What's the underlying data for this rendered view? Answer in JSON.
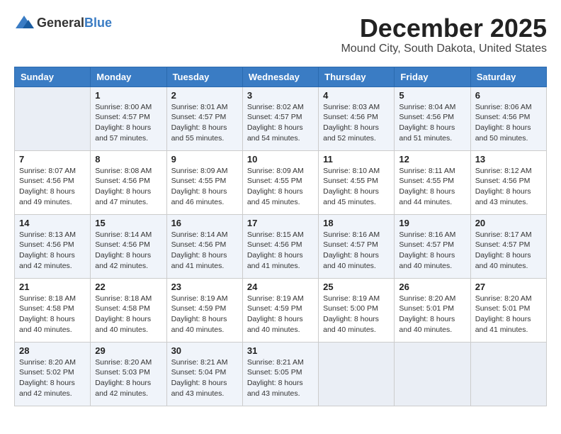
{
  "header": {
    "logo_general": "General",
    "logo_blue": "Blue",
    "month": "December 2025",
    "location": "Mound City, South Dakota, United States"
  },
  "weekdays": [
    "Sunday",
    "Monday",
    "Tuesday",
    "Wednesday",
    "Thursday",
    "Friday",
    "Saturday"
  ],
  "weeks": [
    [
      {
        "day": "",
        "info": ""
      },
      {
        "day": "1",
        "info": "Sunrise: 8:00 AM\nSunset: 4:57 PM\nDaylight: 8 hours\nand 57 minutes."
      },
      {
        "day": "2",
        "info": "Sunrise: 8:01 AM\nSunset: 4:57 PM\nDaylight: 8 hours\nand 55 minutes."
      },
      {
        "day": "3",
        "info": "Sunrise: 8:02 AM\nSunset: 4:57 PM\nDaylight: 8 hours\nand 54 minutes."
      },
      {
        "day": "4",
        "info": "Sunrise: 8:03 AM\nSunset: 4:56 PM\nDaylight: 8 hours\nand 52 minutes."
      },
      {
        "day": "5",
        "info": "Sunrise: 8:04 AM\nSunset: 4:56 PM\nDaylight: 8 hours\nand 51 minutes."
      },
      {
        "day": "6",
        "info": "Sunrise: 8:06 AM\nSunset: 4:56 PM\nDaylight: 8 hours\nand 50 minutes."
      }
    ],
    [
      {
        "day": "7",
        "info": "Sunrise: 8:07 AM\nSunset: 4:56 PM\nDaylight: 8 hours\nand 49 minutes."
      },
      {
        "day": "8",
        "info": "Sunrise: 8:08 AM\nSunset: 4:56 PM\nDaylight: 8 hours\nand 47 minutes."
      },
      {
        "day": "9",
        "info": "Sunrise: 8:09 AM\nSunset: 4:55 PM\nDaylight: 8 hours\nand 46 minutes."
      },
      {
        "day": "10",
        "info": "Sunrise: 8:09 AM\nSunset: 4:55 PM\nDaylight: 8 hours\nand 45 minutes."
      },
      {
        "day": "11",
        "info": "Sunrise: 8:10 AM\nSunset: 4:55 PM\nDaylight: 8 hours\nand 45 minutes."
      },
      {
        "day": "12",
        "info": "Sunrise: 8:11 AM\nSunset: 4:55 PM\nDaylight: 8 hours\nand 44 minutes."
      },
      {
        "day": "13",
        "info": "Sunrise: 8:12 AM\nSunset: 4:56 PM\nDaylight: 8 hours\nand 43 minutes."
      }
    ],
    [
      {
        "day": "14",
        "info": "Sunrise: 8:13 AM\nSunset: 4:56 PM\nDaylight: 8 hours\nand 42 minutes."
      },
      {
        "day": "15",
        "info": "Sunrise: 8:14 AM\nSunset: 4:56 PM\nDaylight: 8 hours\nand 42 minutes."
      },
      {
        "day": "16",
        "info": "Sunrise: 8:14 AM\nSunset: 4:56 PM\nDaylight: 8 hours\nand 41 minutes."
      },
      {
        "day": "17",
        "info": "Sunrise: 8:15 AM\nSunset: 4:56 PM\nDaylight: 8 hours\nand 41 minutes."
      },
      {
        "day": "18",
        "info": "Sunrise: 8:16 AM\nSunset: 4:57 PM\nDaylight: 8 hours\nand 40 minutes."
      },
      {
        "day": "19",
        "info": "Sunrise: 8:16 AM\nSunset: 4:57 PM\nDaylight: 8 hours\nand 40 minutes."
      },
      {
        "day": "20",
        "info": "Sunrise: 8:17 AM\nSunset: 4:57 PM\nDaylight: 8 hours\nand 40 minutes."
      }
    ],
    [
      {
        "day": "21",
        "info": "Sunrise: 8:18 AM\nSunset: 4:58 PM\nDaylight: 8 hours\nand 40 minutes."
      },
      {
        "day": "22",
        "info": "Sunrise: 8:18 AM\nSunset: 4:58 PM\nDaylight: 8 hours\nand 40 minutes."
      },
      {
        "day": "23",
        "info": "Sunrise: 8:19 AM\nSunset: 4:59 PM\nDaylight: 8 hours\nand 40 minutes."
      },
      {
        "day": "24",
        "info": "Sunrise: 8:19 AM\nSunset: 4:59 PM\nDaylight: 8 hours\nand 40 minutes."
      },
      {
        "day": "25",
        "info": "Sunrise: 8:19 AM\nSunset: 5:00 PM\nDaylight: 8 hours\nand 40 minutes."
      },
      {
        "day": "26",
        "info": "Sunrise: 8:20 AM\nSunset: 5:01 PM\nDaylight: 8 hours\nand 40 minutes."
      },
      {
        "day": "27",
        "info": "Sunrise: 8:20 AM\nSunset: 5:01 PM\nDaylight: 8 hours\nand 41 minutes."
      }
    ],
    [
      {
        "day": "28",
        "info": "Sunrise: 8:20 AM\nSunset: 5:02 PM\nDaylight: 8 hours\nand 42 minutes."
      },
      {
        "day": "29",
        "info": "Sunrise: 8:20 AM\nSunset: 5:03 PM\nDaylight: 8 hours\nand 42 minutes."
      },
      {
        "day": "30",
        "info": "Sunrise: 8:21 AM\nSunset: 5:04 PM\nDaylight: 8 hours\nand 43 minutes."
      },
      {
        "day": "31",
        "info": "Sunrise: 8:21 AM\nSunset: 5:05 PM\nDaylight: 8 hours\nand 43 minutes."
      },
      {
        "day": "",
        "info": ""
      },
      {
        "day": "",
        "info": ""
      },
      {
        "day": "",
        "info": ""
      }
    ]
  ]
}
